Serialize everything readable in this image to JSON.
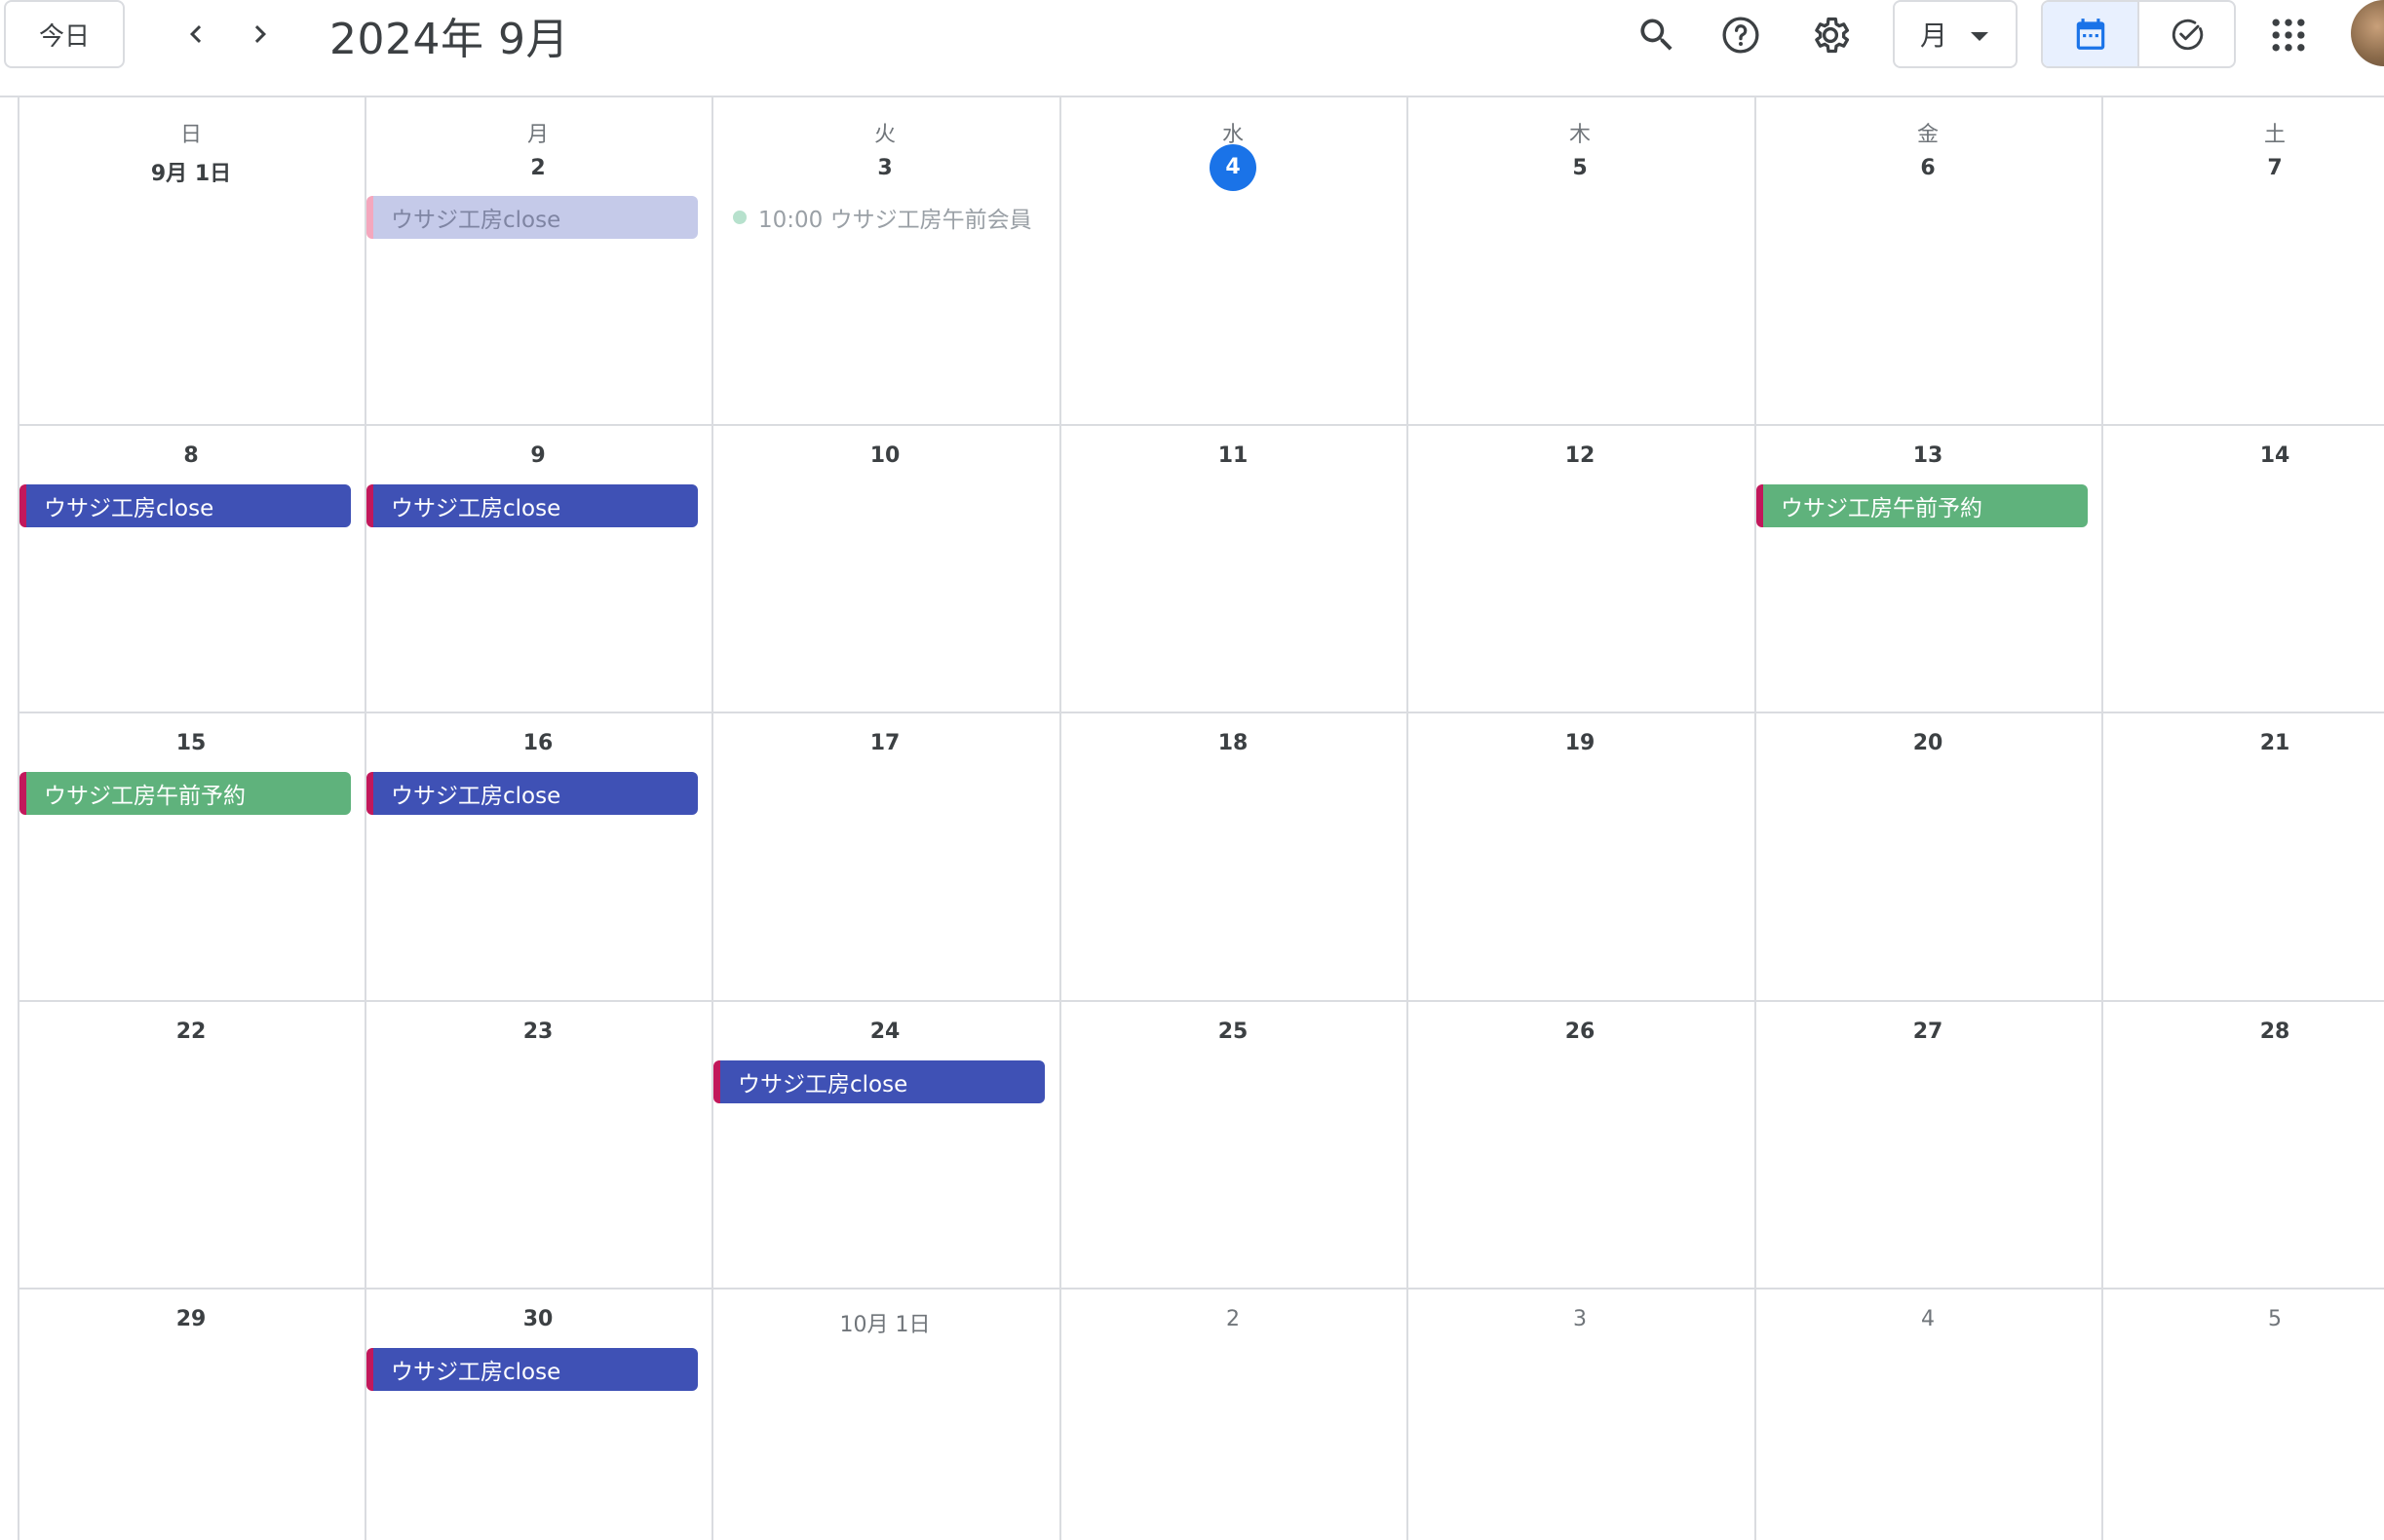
{
  "header": {
    "today_label": "今日",
    "title": "2024年 9月",
    "view_select": "月",
    "icons": [
      "chevron-left-icon",
      "chevron-right-icon",
      "search-icon",
      "help-icon",
      "settings-icon",
      "calendar-icon",
      "tasks-check-icon",
      "apps-grid-icon"
    ]
  },
  "weekdays": [
    "日",
    "月",
    "火",
    "水",
    "木",
    "金",
    "土"
  ],
  "weeks": [
    [
      "9月 1日",
      "2",
      "3",
      "4",
      "5",
      "6",
      "7"
    ],
    [
      "8",
      "9",
      "10",
      "11",
      "12",
      "13",
      "14"
    ],
    [
      "15",
      "16",
      "17",
      "18",
      "19",
      "20",
      "21"
    ],
    [
      "22",
      "23",
      "24",
      "25",
      "26",
      "27",
      "28"
    ],
    [
      "29",
      "30",
      "10月 1日",
      "2",
      "3",
      "4",
      "5"
    ]
  ],
  "events": {
    "e_0_1": "ウサジ工房close",
    "e_0_2": "10:00 ウサジ工房午前会員",
    "e_1_0": "ウサジ工房close",
    "e_1_1": "ウサジ工房close",
    "e_1_5": "ウサジ工房午前予約",
    "e_2_0": "ウサジ工房午前予約",
    "e_2_1": "ウサジ工房close",
    "e_3_2": "ウサジ工房close",
    "e_4_1": "ウサジ工房close"
  },
  "colors": {
    "accent": "#1a73e8",
    "event_blue": "#3f51b5",
    "event_green": "#5fb27c",
    "event_past": "#c5cae9",
    "event_stripe": "#c2185b"
  }
}
